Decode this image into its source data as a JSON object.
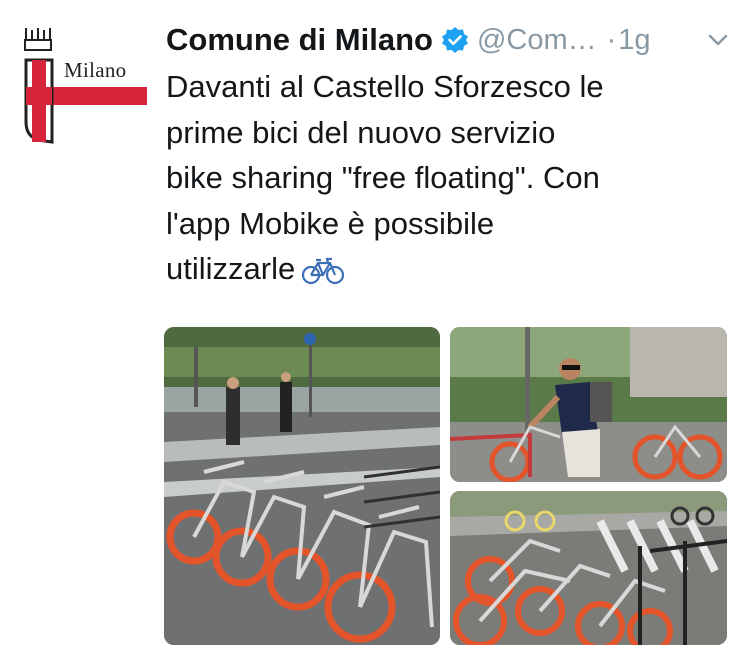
{
  "author": {
    "name": "Comune di Milano",
    "handle": "@Com…",
    "separator": "·",
    "time": "1g",
    "logo_text": "Milano",
    "verified": true
  },
  "tweet": {
    "lines": [
      "Davanti al Castello Sforzesco le",
      "prime bici del nuovo servizio",
      "bike sharing \"free floating\". Con",
      "l'app Mobike è possibile",
      "utilizzarle"
    ],
    "emoji": "bicycle-icon"
  },
  "colors": {
    "brand_red": "#d6243b",
    "verified_blue": "#1da1f2",
    "muted": "#8899a6",
    "text": "#14171a",
    "bike_orange": "#e3542a"
  },
  "media": {
    "count": 3,
    "items": [
      "bikes-at-castello-photo",
      "man-with-bike-photo",
      "parked-bikes-photo"
    ]
  }
}
